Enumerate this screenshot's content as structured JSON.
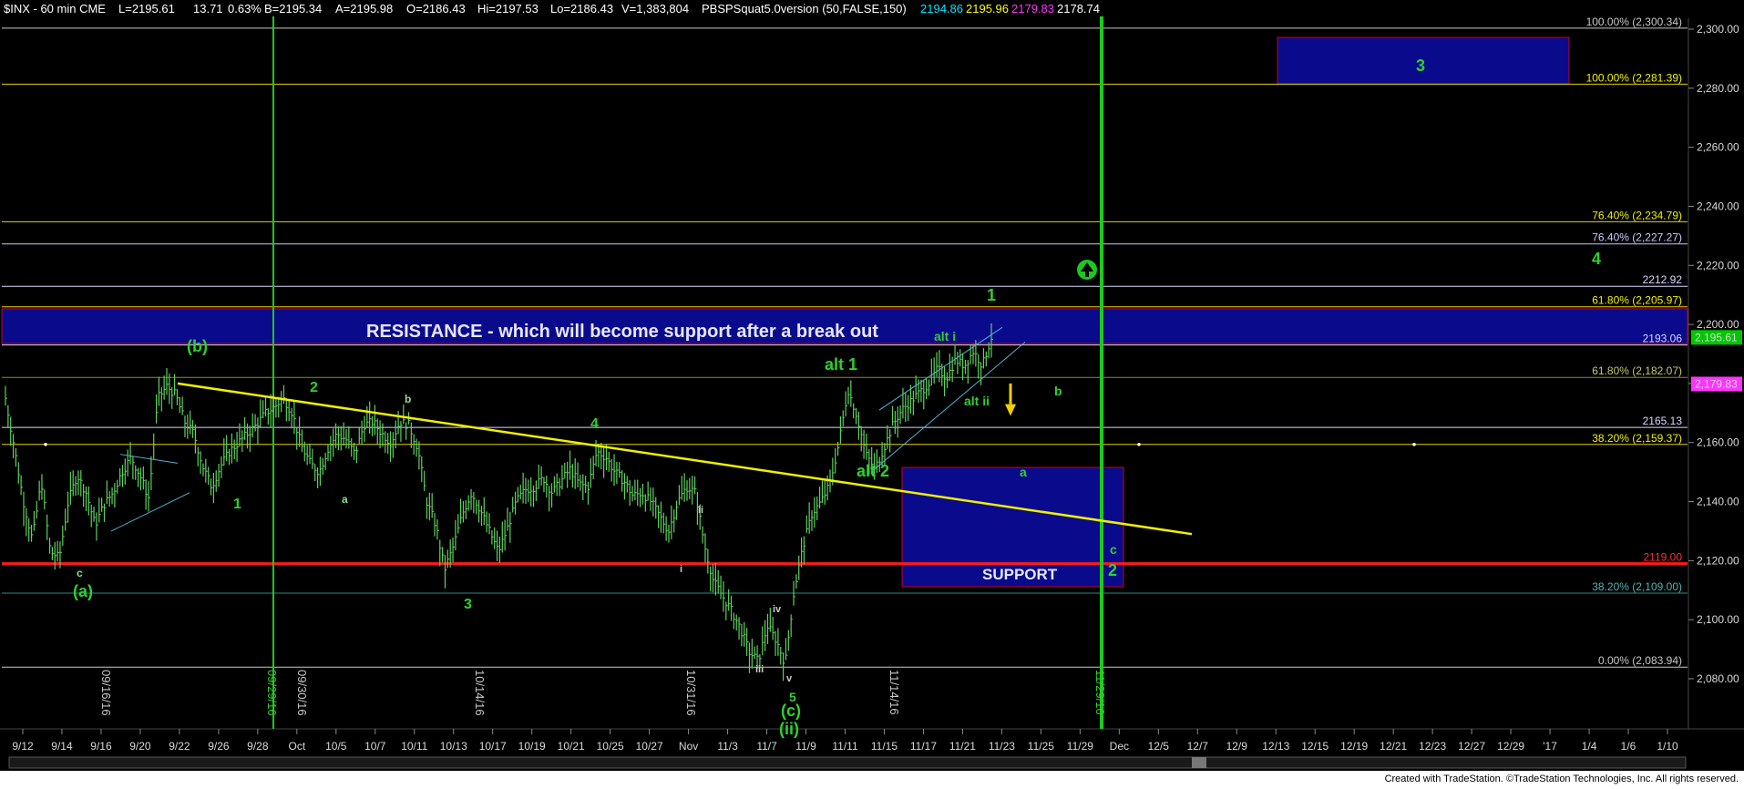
{
  "header": {
    "symbol": "$INX - 60 min  CME",
    "last": "L=2195.61",
    "change": "13.71",
    "change_pct": "0.63%",
    "bid": "B=2195.34",
    "ask": "A=2195.98",
    "open": "O=2186.43",
    "high": "Hi=2197.53",
    "low": "Lo=2186.43",
    "volume": "V=1,383,804",
    "indicator": "PBSPSquat5.0version (50,FALSE,150)",
    "ind_v1": "2194.86",
    "ind_v2": "2195.96",
    "ind_v3": "2179.83",
    "ind_v4": "2178.74"
  },
  "footer": {
    "credit": "Created with TradeStation. ©TradeStation Technologies, Inc. All rights reserved."
  },
  "colors": {
    "background": "#000000",
    "price_bar": "#5fcf5f",
    "trendline": "#f0f000",
    "support_line": "#ff1a1a",
    "zone_fill": "#0a0a8c",
    "wave_label": "#2fd02f",
    "vline": "#1ec81e"
  },
  "chart_data": {
    "type": "line",
    "title": "",
    "xlabel": "",
    "ylabel": "",
    "ylim": [
      2070,
      2310
    ],
    "y_ticks": [
      "2,300.00",
      "2,280.00",
      "2,260.00",
      "2,240.00",
      "2,220.00",
      "2,200.00",
      "2,180.00",
      "2,160.00",
      "2,140.00",
      "2,120.00",
      "2,100.00",
      "2,080.00"
    ],
    "x_ticks": [
      "9/12",
      "9/14",
      "9/16",
      "9/20",
      "9/22",
      "9/26",
      "9/28",
      "Oct",
      "10/5",
      "10/7",
      "10/11",
      "10/13",
      "10/17",
      "10/19",
      "10/21",
      "10/25",
      "10/27",
      "Nov",
      "11/3",
      "11/7",
      "11/9",
      "11/11",
      "11/15",
      "11/17",
      "11/21",
      "11/23",
      "11/25",
      "11/29",
      "Dec",
      "12/5",
      "12/7",
      "12/9",
      "12/13",
      "12/15",
      "12/19",
      "12/21",
      "12/23",
      "12/27",
      "12/29",
      "'17",
      "1/4",
      "1/6",
      "1/10"
    ],
    "last_price": "2,195.61",
    "last_price_value": 2195.61,
    "ind_marker": "2,179.83",
    "ind_marker_value": 2179.83,
    "series": [
      {
        "values": [
          2175,
          2158,
          2140,
          2127,
          2147,
          2123,
          2121,
          2140,
          2149,
          2143,
          2132,
          2139,
          2143,
          2150,
          2155,
          2149,
          2141,
          2175,
          2179,
          2176,
          2167,
          2163,
          2152,
          2145,
          2152,
          2157,
          2160,
          2163,
          2166,
          2170,
          2172,
          2175,
          2170,
          2159,
          2153,
          2150,
          2158,
          2163,
          2161,
          2156,
          2166,
          2167,
          2163,
          2160,
          2167,
          2166,
          2158,
          2140,
          2132,
          2117,
          2125,
          2136,
          2143,
          2137,
          2130,
          2123,
          2131,
          2140,
          2144,
          2145,
          2148,
          2143,
          2147,
          2151,
          2146,
          2145,
          2157,
          2155,
          2150,
          2147,
          2142,
          2143,
          2140,
          2135,
          2130,
          2140,
          2145,
          2143,
          2125,
          2113,
          2108,
          2103,
          2097,
          2089,
          2086,
          2098,
          2093,
          2085,
          2110,
          2125,
          2136,
          2140,
          2146,
          2160,
          2178,
          2169,
          2156,
          2151,
          2158,
          2166,
          2171,
          2174,
          2177,
          2180,
          2185,
          2182,
          2188,
          2186,
          2191,
          2186,
          2195.61
        ]
      }
    ],
    "horizontal_levels": [
      {
        "label": "100.00% (2,300.34)",
        "value": 2300.34
      },
      {
        "label": "100.00% (2,281.39)",
        "value": 2281.39
      },
      {
        "label": "76.40% (2,234.79)",
        "value": 2234.79
      },
      {
        "label": "76.40% (2,227.27)",
        "value": 2227.27
      },
      {
        "label": "2212.92",
        "value": 2212.92
      },
      {
        "label": "61.80% (2,205.97)",
        "value": 2205.97
      },
      {
        "label": "2193.06",
        "value": 2193.06
      },
      {
        "label": "61.80% (2,182.07)",
        "value": 2182.07
      },
      {
        "label": "2165.13",
        "value": 2165.13
      },
      {
        "label": "38.20% (2,159.37)",
        "value": 2159.37
      },
      {
        "label": "2119.00",
        "value": 2119.0
      },
      {
        "label": "38.20% (2,109.00)",
        "value": 2109.0
      },
      {
        "label": "0.00% (2,083.94)",
        "value": 2083.94
      }
    ],
    "annotations": {
      "resistance_text": "RESISTANCE - which will become support after a break out",
      "support_text": "SUPPORT",
      "target_box_label": "3",
      "waves": [
        "(b)",
        "(a)",
        "1",
        "2",
        "3",
        "4",
        "c",
        "b",
        "a",
        "i",
        "ii",
        "iii",
        "iv",
        "v",
        "alt 1",
        "alt 2",
        "alt i",
        "alt ii",
        "1",
        "4",
        "2",
        "c",
        "a",
        "b",
        "(c)",
        "(ii)",
        "5"
      ],
      "vertical_dates": [
        "09/16/16",
        "09/29/16",
        "09/30/16",
        "10/14/16",
        "10/31/16",
        "11/14/16",
        "11/29/16"
      ]
    }
  }
}
